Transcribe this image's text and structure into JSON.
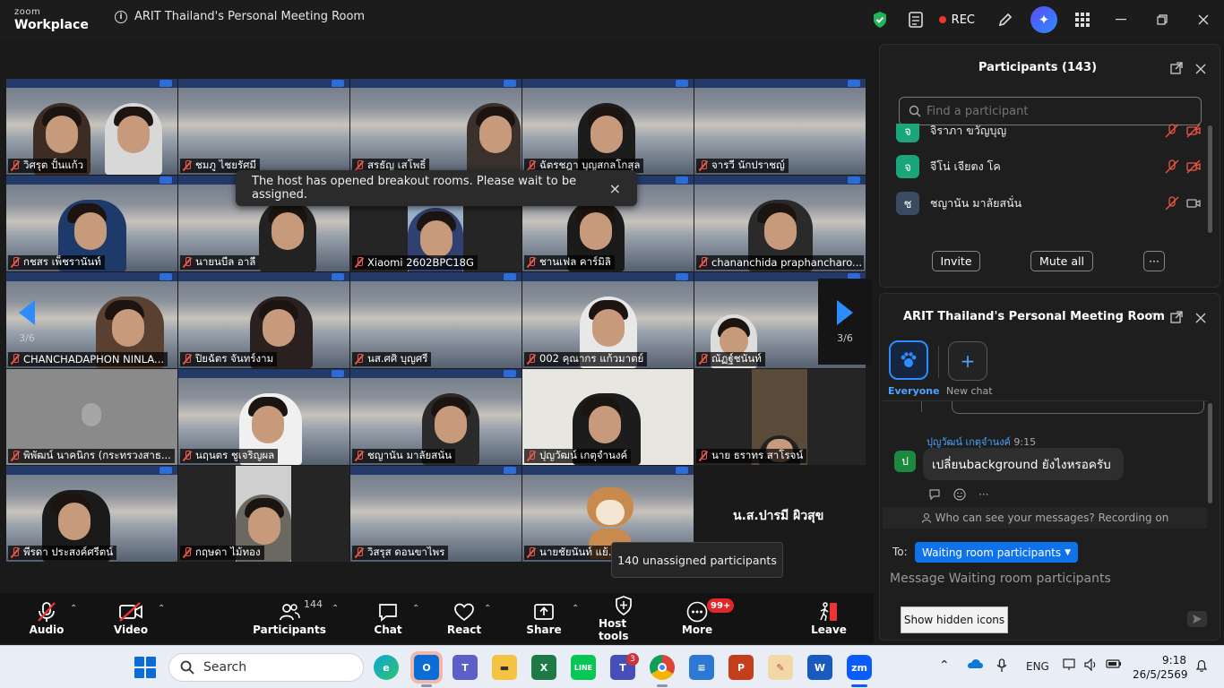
{
  "titlebar": {
    "logo_top": "zoom",
    "logo_bottom": "Workplace",
    "meeting_title": "ARIT Thailand's Personal Meeting Room",
    "rec_label": "REC"
  },
  "gallery": {
    "toast_text": "The host has opened breakout rooms. Please wait to be assigned.",
    "toast_close": "×",
    "page_left": "3/6",
    "page_right": "3/6",
    "active_speaker_name": "น.ส.ปารมี ผิวสุข",
    "unassigned_tooltip": "140 unassigned participants",
    "tiles": [
      {
        "name": "วิศรุต ปั้นแก้ว"
      },
      {
        "name": "ชมภู ไชยรัศมี"
      },
      {
        "name": "สรธัญ เสโพธิ์"
      },
      {
        "name": "ฉัตรชฎา บุญสกลโกสุล"
      },
      {
        "name": "จารวี นักปราชญ์"
      },
      {
        "name": "กชสร เพ็ชรานันท์"
      },
      {
        "name": "นายนบีล อาลี"
      },
      {
        "name": "Xiaomi 2602BPC18G"
      },
      {
        "name": "ชานเฟล คาร์มิลิ"
      },
      {
        "name": "chananchida praphancharo..."
      },
      {
        "name": "CHANCHADAPHON NINLA..."
      },
      {
        "name": "ปิยฉัตร จันทร์งาม"
      },
      {
        "name": "นส.ศศิ บุญศรี"
      },
      {
        "name": "002 คุณากร แก้วมาตย์"
      },
      {
        "name": "ณัฏฐ์ชนันท์"
      },
      {
        "name": "พิพัฒน์  นาคนิกร (กระทรวงสาธ..."
      },
      {
        "name": "นฤนตร ชูเจริญผล"
      },
      {
        "name": "ชญานัน มาลัยสนั่น"
      },
      {
        "name": "ปุญวัฒน์ เกตุจำนงค์"
      },
      {
        "name": "นาย ธราทร สาโรจน์"
      },
      {
        "name": "พีรดา ประสงค์ศรีตน์"
      },
      {
        "name": "กฤษดา ไม้ทอง"
      },
      {
        "name": "วิสรุส ดอนขาไพร"
      },
      {
        "name": "นายชัยนันท์ แย้..."
      }
    ]
  },
  "toolbar": {
    "audio": "Audio",
    "video": "Video",
    "participants": "Participants",
    "participants_count": "144",
    "chat": "Chat",
    "react": "React",
    "share": "Share",
    "host_tools": "Host tools",
    "more": "More",
    "more_badge": "99+",
    "leave": "Leave",
    "show_hidden_icons": "Show hidden icons"
  },
  "participants_panel": {
    "title": "Participants (143)",
    "search_placeholder": "Find a participant",
    "rows": [
      {
        "initial": "จ",
        "name": "จิราภา  ขวัญบุญ",
        "color": "#1aa57a"
      },
      {
        "initial": "จ",
        "name": "จีโน่ เจียตง โค",
        "color": "#1aa57a"
      },
      {
        "initial": "ช",
        "name": "ชญานัน มาลัยสนั่น",
        "color": "#3a4a60"
      }
    ],
    "invite": "Invite",
    "mute_all": "Mute all",
    "more": "···"
  },
  "chat_panel": {
    "title": "ARIT Thailand's Personal Meeting Room",
    "everyone": "Everyone",
    "new_chat": "New chat",
    "sender": "ปุญวัฒน์ เกตุจำนงค์",
    "time": "9:15",
    "sender_initial": "ป",
    "message": "เปลี่ยนbackground ยังไงหรอครับ",
    "notice": "Who can see your messages? Recording on",
    "to_label": "To:",
    "to_target": "Waiting room participants",
    "input_placeholder": "Message Waiting room participants"
  },
  "taskbar": {
    "search_label": "Search",
    "teams_badge": "3",
    "lang": "ENG",
    "time": "9:18",
    "date": "26/5/2569"
  }
}
